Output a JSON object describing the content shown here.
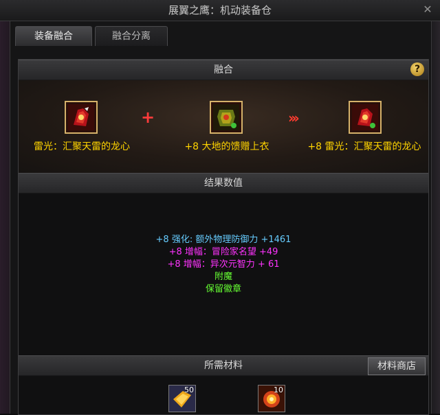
{
  "window": {
    "title": "展翼之鹰：机动装备仓"
  },
  "tabs": [
    {
      "label": "装备融合",
      "active": true
    },
    {
      "label": "融合分离",
      "active": false
    }
  ],
  "fusion": {
    "header": "融合",
    "items": [
      {
        "name": "雷光：汇聚天雷的龙心",
        "icon": "red-dragon-heart-icon"
      },
      {
        "name": "+8 大地的馈赠上衣",
        "icon": "green-armor-icon"
      },
      {
        "name": "+8 雷光：汇聚天雷的龙心",
        "icon": "red-dragon-heart-icon"
      }
    ],
    "plus_symbol": "+",
    "arrow_symbol": "›››"
  },
  "results": {
    "header": "结果数值",
    "lines": [
      {
        "text": "+8 强化: 额外物理防御力 +1461",
        "color": "#66ccff"
      },
      {
        "text": "+8 增幅：冒险家名望 +49",
        "color": "#ff33ff"
      },
      {
        "text": "+8 增幅：异次元智力 + 61",
        "color": "#ff33ff"
      },
      {
        "text": "附魔",
        "color": "#66ff33"
      },
      {
        "text": "保留徽章",
        "color": "#66ff33"
      }
    ]
  },
  "materials": {
    "header": "所需材料",
    "store_button": "材料商店",
    "items": [
      {
        "icon": "gold-ticket-icon",
        "count": "50"
      },
      {
        "icon": "orange-burst-icon",
        "count": "10"
      }
    ]
  },
  "colors": {
    "item_name": "#ffd400",
    "plus": "#ff3b3b",
    "enhance": "#66ccff",
    "amplify": "#ff33ff",
    "enchant": "#66ff33"
  }
}
